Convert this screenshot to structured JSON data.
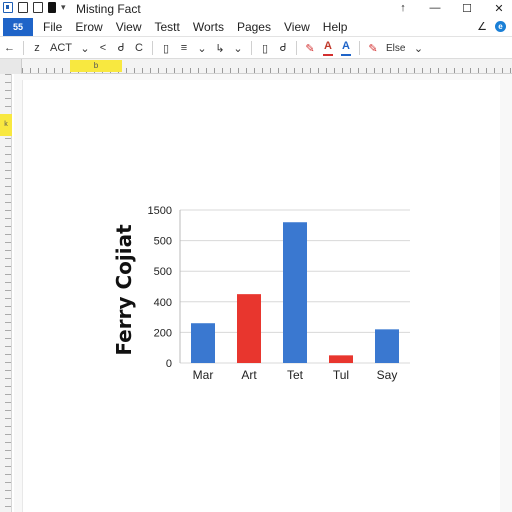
{
  "titlebar": {
    "title": "Misting Fact",
    "controls": [
      "↑",
      "—",
      "☐",
      "✕"
    ]
  },
  "menubar": {
    "file_tab": "55",
    "items": [
      "File",
      "Erow",
      "View",
      "Testt",
      "Worts",
      "Pages",
      "View",
      "Help"
    ],
    "right_chevron": "∠"
  },
  "toolbar": {
    "items": [
      "←",
      "z",
      "ACT",
      "⌄",
      "<",
      "Ꮷ",
      "C",
      "▯",
      "≡",
      "⌄",
      "↳",
      "⌄",
      "▯",
      "Ꮷ",
      "✎",
      "A",
      "A",
      "✎",
      "Else",
      "⌄"
    ],
    "style_label": "Else"
  },
  "ruler": {
    "marker": "b"
  },
  "vruler": {
    "marker": "k"
  },
  "chart_data": {
    "type": "bar",
    "title": "",
    "xlabel": "",
    "ylabel": "Ferry Cojiat",
    "categories": [
      "Mar",
      "Art",
      "Tet",
      "Tul",
      "Say"
    ],
    "values": [
      260,
      450,
      920,
      50,
      220
    ],
    "colors": [
      "#3a78d0",
      "#e8362e",
      "#3a78d0",
      "#e8362e",
      "#3a78d0"
    ],
    "ytick_labels": [
      "0",
      "200",
      "400",
      "500",
      "500",
      "1500"
    ],
    "ytick_values": [
      0,
      200,
      400,
      600,
      800,
      1000
    ],
    "ylim": [
      0,
      1000
    ],
    "grid": true,
    "legend": "none"
  },
  "colors": {
    "accent": "#1f64c8",
    "bar_blue": "#3a78d0",
    "bar_red": "#e8362e"
  }
}
